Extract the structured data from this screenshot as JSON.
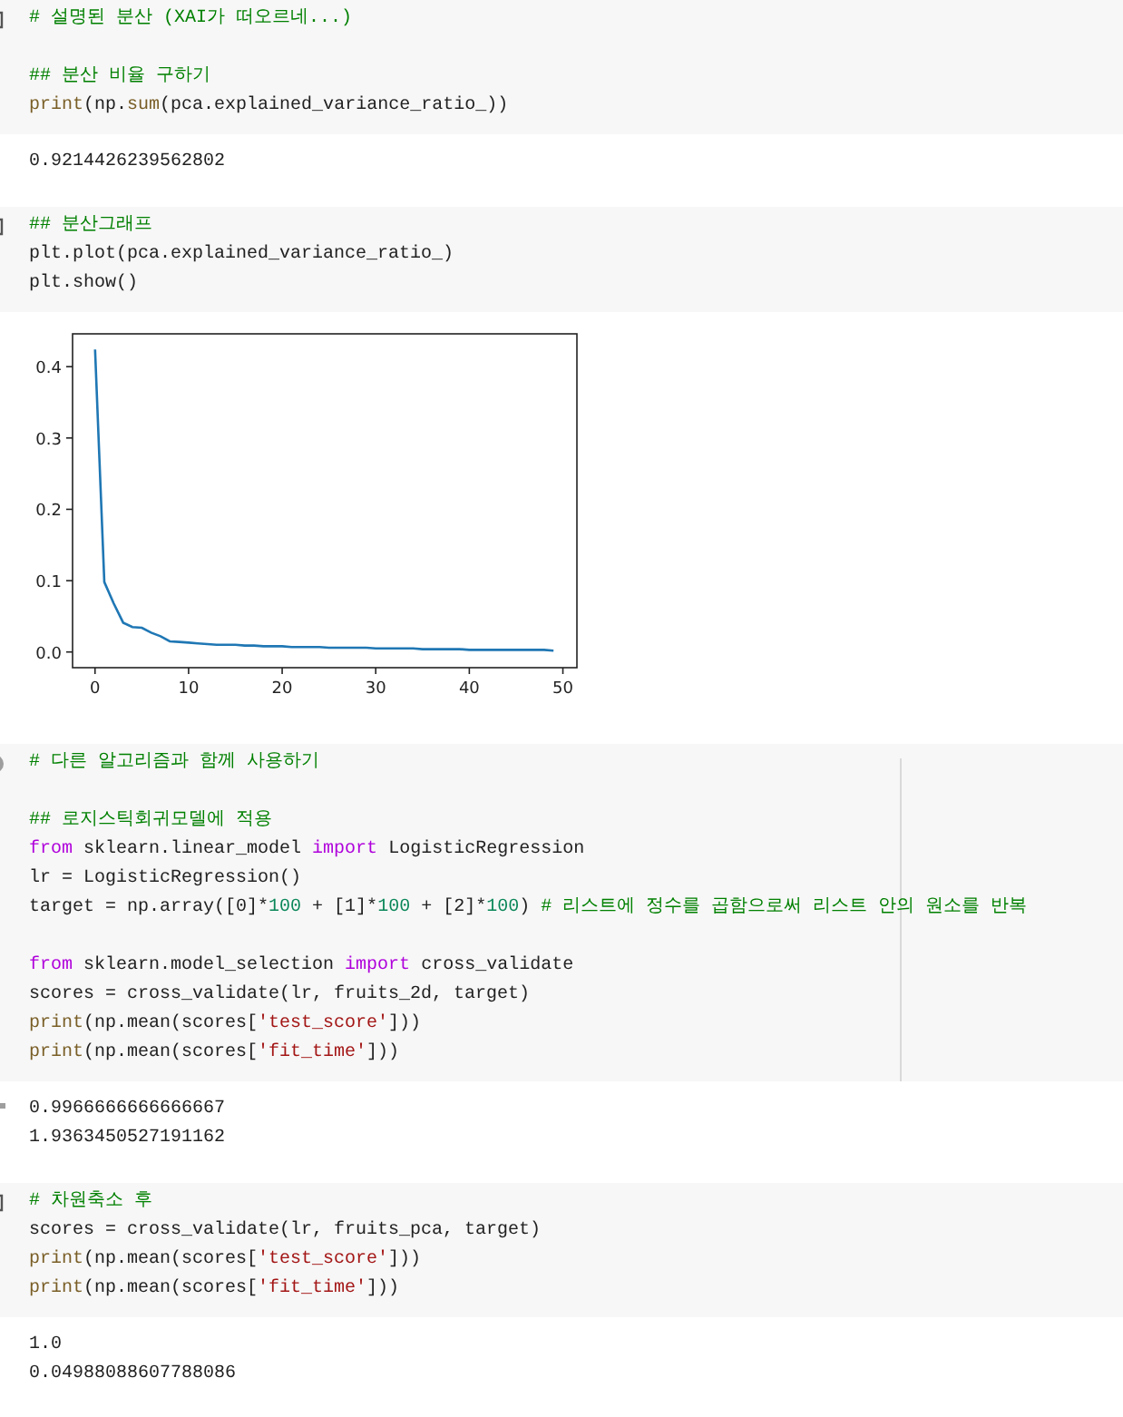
{
  "cells": [
    {
      "marker": {
        "kind": "bracket"
      },
      "ruler": false,
      "code": [
        {
          "kind": "code",
          "tokens": [
            {
              "kind": "comment",
              "text": "# 설명된 분산 (XAI가 떠오르네...)"
            }
          ]
        },
        {
          "kind": "blank"
        },
        {
          "kind": "code",
          "tokens": [
            {
              "kind": "comment",
              "text": "## 분산 비율 구하기"
            }
          ]
        },
        {
          "kind": "code",
          "tokens": [
            {
              "kind": "builtin",
              "text": "print"
            },
            {
              "kind": "plain",
              "text": "(np."
            },
            {
              "kind": "builtin",
              "text": "sum"
            },
            {
              "kind": "plain",
              "text": "(pca.explained_variance_ratio_))"
            }
          ]
        }
      ],
      "output": {
        "kind": "text",
        "lines": [
          "0.9214426239562802"
        ]
      }
    },
    {
      "marker": {
        "kind": "bracket"
      },
      "ruler": false,
      "code": [
        {
          "kind": "code",
          "tokens": [
            {
              "kind": "comment",
              "text": "## 분산그래프"
            }
          ]
        },
        {
          "kind": "code",
          "tokens": [
            {
              "kind": "plain",
              "text": "plt.plot(pca.explained_variance_ratio_)"
            }
          ]
        },
        {
          "kind": "code",
          "tokens": [
            {
              "kind": "plain",
              "text": "plt.show()"
            }
          ]
        }
      ],
      "output": {
        "kind": "chart",
        "chart_data": {
          "type": "line",
          "x": [
            0,
            1,
            2,
            3,
            4,
            5,
            6,
            7,
            8,
            9,
            10,
            11,
            12,
            13,
            14,
            15,
            16,
            17,
            18,
            19,
            20,
            21,
            22,
            23,
            24,
            25,
            26,
            27,
            28,
            29,
            30,
            31,
            32,
            33,
            34,
            35,
            36,
            37,
            38,
            39,
            40,
            41,
            42,
            43,
            44,
            45,
            46,
            47,
            48,
            49
          ],
          "series": [
            {
              "color": "#1f77b4",
              "values": [
                0.424,
                0.098,
                0.068,
                0.041,
                0.035,
                0.034,
                0.027,
                0.022,
                0.015,
                0.014,
                0.013,
                0.012,
                0.011,
                0.01,
                0.01,
                0.01,
                0.009,
                0.009,
                0.008,
                0.008,
                0.008,
                0.007,
                0.007,
                0.007,
                0.007,
                0.006,
                0.006,
                0.006,
                0.006,
                0.006,
                0.005,
                0.005,
                0.005,
                0.005,
                0.005,
                0.004,
                0.004,
                0.004,
                0.004,
                0.004,
                0.003,
                0.003,
                0.003,
                0.003,
                0.003,
                0.003,
                0.003,
                0.003,
                0.003,
                0.002
              ]
            }
          ],
          "xlim": [
            -2.4,
            51.5
          ],
          "ylim": [
            -0.022,
            0.446
          ],
          "xticks": [
            0,
            10,
            20,
            30,
            40,
            50
          ],
          "yticks": [
            {
              "value": 0,
              "label": "0.0"
            },
            {
              "value": 0.1,
              "label": "0.1"
            },
            {
              "value": 0.2,
              "label": "0.2"
            },
            {
              "value": 0.3,
              "label": "0.3"
            },
            {
              "value": 0.4,
              "label": "0.4"
            }
          ]
        }
      }
    },
    {
      "marker": {
        "kind": "circle"
      },
      "ruler": true,
      "code": [
        {
          "kind": "code",
          "tokens": [
            {
              "kind": "comment",
              "text": "# 다른 알고리즘과 함께 사용하기"
            }
          ]
        },
        {
          "kind": "blank"
        },
        {
          "kind": "code",
          "tokens": [
            {
              "kind": "comment",
              "text": "## 로지스틱회귀모델에 적용"
            }
          ]
        },
        {
          "kind": "code",
          "tokens": [
            {
              "kind": "keyword",
              "text": "from"
            },
            {
              "kind": "plain",
              "text": " sklearn.linear_model "
            },
            {
              "kind": "keyword",
              "text": "import"
            },
            {
              "kind": "plain",
              "text": " LogisticRegression"
            }
          ]
        },
        {
          "kind": "code",
          "tokens": [
            {
              "kind": "plain",
              "text": "lr = LogisticRegression()"
            }
          ]
        },
        {
          "kind": "code",
          "tokens": [
            {
              "kind": "plain",
              "text": "target = np.array([0]*"
            },
            {
              "kind": "number",
              "text": "100"
            },
            {
              "kind": "plain",
              "text": " + [1]*"
            },
            {
              "kind": "number",
              "text": "100"
            },
            {
              "kind": "plain",
              "text": " + [2]*"
            },
            {
              "kind": "number",
              "text": "100"
            },
            {
              "kind": "plain",
              "text": ") "
            },
            {
              "kind": "comment",
              "text": "# 리스트에 정수를 곱함으로써 리스트 안의 원소를 반복"
            }
          ]
        },
        {
          "kind": "blank"
        },
        {
          "kind": "code",
          "tokens": [
            {
              "kind": "keyword",
              "text": "from"
            },
            {
              "kind": "plain",
              "text": " sklearn.model_selection "
            },
            {
              "kind": "keyword",
              "text": "import"
            },
            {
              "kind": "plain",
              "text": " cross_validate"
            }
          ]
        },
        {
          "kind": "code",
          "tokens": [
            {
              "kind": "plain",
              "text": "scores = cross_validate(lr, fruits_2d, target)"
            }
          ]
        },
        {
          "kind": "code",
          "tokens": [
            {
              "kind": "builtin",
              "text": "print"
            },
            {
              "kind": "plain",
              "text": "(np.mean(scores["
            },
            {
              "kind": "string",
              "text": "'test_score'"
            },
            {
              "kind": "plain",
              "text": "]))"
            }
          ]
        },
        {
          "kind": "code",
          "tokens": [
            {
              "kind": "builtin",
              "text": "print"
            },
            {
              "kind": "plain",
              "text": "(np.mean(scores["
            },
            {
              "kind": "string",
              "text": "'fit_time'"
            },
            {
              "kind": "plain",
              "text": "]))"
            }
          ]
        }
      ],
      "output": {
        "kind": "text",
        "lines": [
          "0.9966666666666667",
          "1.9363450527191162"
        ]
      }
    },
    {
      "marker": {
        "kind": "bracket"
      },
      "ruler": false,
      "code": [
        {
          "kind": "code",
          "tokens": [
            {
              "kind": "comment",
              "text": "# 차원축소 후"
            }
          ]
        },
        {
          "kind": "code",
          "tokens": [
            {
              "kind": "plain",
              "text": "scores = cross_validate(lr, fruits_pca, target)"
            }
          ]
        },
        {
          "kind": "code",
          "tokens": [
            {
              "kind": "builtin",
              "text": "print"
            },
            {
              "kind": "plain",
              "text": "(np.mean(scores["
            },
            {
              "kind": "string",
              "text": "'test_score'"
            },
            {
              "kind": "plain",
              "text": "]))"
            }
          ]
        },
        {
          "kind": "code",
          "tokens": [
            {
              "kind": "builtin",
              "text": "print"
            },
            {
              "kind": "plain",
              "text": "(np.mean(scores["
            },
            {
              "kind": "string",
              "text": "'fit_time'"
            },
            {
              "kind": "plain",
              "text": "]))"
            }
          ]
        }
      ],
      "output": {
        "kind": "text",
        "lines": [
          "1.0",
          "0.04988088607788086"
        ]
      }
    }
  ]
}
